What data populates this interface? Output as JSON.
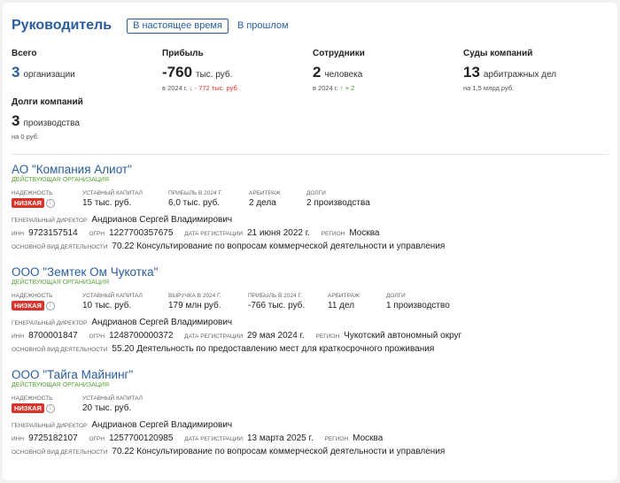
{
  "header": {
    "title": "Руководитель",
    "tab_present": "В настоящее время",
    "tab_past": "В прошлом"
  },
  "stats": {
    "total": {
      "label": "Всего",
      "value": "3",
      "unit": "организации"
    },
    "profit": {
      "label": "Прибыль",
      "value": "-760",
      "unit": "тыс. руб.",
      "sub_prefix": "в 2024 г.",
      "sub_arrow": "↓",
      "sub_change": "- 772 тыс. руб."
    },
    "staff": {
      "label": "Сотрудники",
      "value": "2",
      "unit": "человека",
      "sub_prefix": "в 2024 г.",
      "sub_arrow": "↑",
      "sub_change": "+ 2"
    },
    "courts": {
      "label": "Суды компаний",
      "value": "13",
      "unit": "арбитражных дел",
      "sub": "на 1,5 млрд руб."
    },
    "debts": {
      "label": "Долги компаний",
      "value": "3",
      "unit": "производства",
      "sub": "на 0 руб."
    }
  },
  "labels": {
    "reliability": "Надежность",
    "capital": "Уставный капитал",
    "profit_2024": "Прибыль в 2024 г.",
    "revenue_2024": "Выручка в 2024 г.",
    "arbitration": "Арбитраж",
    "debts": "Долги",
    "director": "Генеральный директор",
    "inn": "ИНН",
    "ogrn": "ОГРН",
    "reg_date": "Дата регистрации",
    "region": "Регион",
    "activity": "Основной вид деятельности",
    "info_icon": "i"
  },
  "companies": [
    {
      "name": "АО \"Компания Алиот\"",
      "status": "ДЕЙСТВУЮЩАЯ ОРГАНИЗАЦИЯ",
      "reliability": "НИЗКАЯ",
      "capital": "15 тыс. руб.",
      "profit": "6,0 тыс. руб.",
      "arbitration": "2 дела",
      "debts": "2 производства",
      "director": "Андрианов Сергей Владимирович",
      "inn": "9723157514",
      "ogrn": "1227700357675",
      "reg_date": "21 июня 2022 г.",
      "region": "Москва",
      "activity": "70.22 Консультирование по вопросам коммерческой деятельности и управления"
    },
    {
      "name": "ООО \"Земтек Ом Чукотка\"",
      "status": "ДЕЙСТВУЮЩАЯ ОРГАНИЗАЦИЯ",
      "reliability": "НИЗКАЯ",
      "capital": "10 тыс. руб.",
      "revenue": "179 млн руб.",
      "profit": "-766 тыс. руб.",
      "arbitration": "11 дел",
      "debts": "1 производство",
      "director": "Андрианов Сергей Владимирович",
      "inn": "8700001847",
      "ogrn": "1248700000372",
      "reg_date": "29 мая 2024 г.",
      "region": "Чукотский автономный округ",
      "activity": "55.20 Деятельность по предоставлению мест для краткосрочного проживания"
    },
    {
      "name": "ООО \"Тайга Майнинг\"",
      "status": "ДЕЙСТВУЮЩАЯ ОРГАНИЗАЦИЯ",
      "reliability": "НИЗКАЯ",
      "capital": "20 тыс. руб.",
      "director": "Андрианов Сергей Владимирович",
      "inn": "9725182107",
      "ogrn": "1257700120985",
      "reg_date": "13 марта 2025 г.",
      "region": "Москва",
      "activity": "70.22 Консультирование по вопросам коммерческой деятельности и управления"
    }
  ]
}
